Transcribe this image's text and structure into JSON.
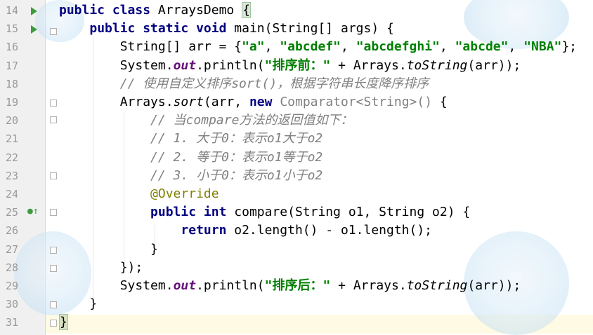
{
  "editor": {
    "lines": [
      {
        "n": "14",
        "segments": [
          {
            "c": "kw",
            "t": "public "
          },
          {
            "c": "kw",
            "t": "class "
          },
          {
            "c": "",
            "t": "ArraysDemo "
          },
          {
            "c": "brace-match",
            "t": "{"
          }
        ]
      },
      {
        "n": "15",
        "segments": [
          {
            "c": "",
            "t": "    "
          },
          {
            "c": "kw",
            "t": "public "
          },
          {
            "c": "kw",
            "t": "static "
          },
          {
            "c": "kw",
            "t": "void "
          },
          {
            "c": "",
            "t": "main(String[] args) {"
          }
        ]
      },
      {
        "n": "16",
        "segments": [
          {
            "c": "",
            "t": "        String[] arr = {"
          },
          {
            "c": "str",
            "t": "\"a\""
          },
          {
            "c": "",
            "t": ", "
          },
          {
            "c": "str",
            "t": "\"abcdef\""
          },
          {
            "c": "",
            "t": ", "
          },
          {
            "c": "str",
            "t": "\"abcdefghi\""
          },
          {
            "c": "",
            "t": ", "
          },
          {
            "c": "str",
            "t": "\"abcde\""
          },
          {
            "c": "",
            "t": ", "
          },
          {
            "c": "str",
            "t": "\"NBA\""
          },
          {
            "c": "",
            "t": "};"
          }
        ]
      },
      {
        "n": "17",
        "segments": [
          {
            "c": "",
            "t": "        System."
          },
          {
            "c": "static",
            "t": "out"
          },
          {
            "c": "",
            "t": ".println("
          },
          {
            "c": "str",
            "t": "\"排序前：\""
          },
          {
            "c": "",
            "t": " + Arrays."
          },
          {
            "c": "method-italic",
            "t": "toString"
          },
          {
            "c": "",
            "t": "(arr));"
          }
        ]
      },
      {
        "n": "18",
        "segments": [
          {
            "c": "cmt",
            "t": "        // 使用自定义排序sort()，根据字符串长度降序排序"
          }
        ]
      },
      {
        "n": "19",
        "segments": [
          {
            "c": "",
            "t": "        Arrays."
          },
          {
            "c": "method-italic",
            "t": "sort"
          },
          {
            "c": "",
            "t": "(arr, "
          },
          {
            "c": "kw",
            "t": "new "
          },
          {
            "c": "gray",
            "t": "Comparator<String>() "
          },
          {
            "c": "",
            "t": "{"
          }
        ]
      },
      {
        "n": "20",
        "segments": [
          {
            "c": "cmt",
            "t": "            // 当compare方法的返回值如下："
          }
        ]
      },
      {
        "n": "21",
        "segments": [
          {
            "c": "cmt",
            "t": "            // 1. 大于0：表示o1大于o2"
          }
        ]
      },
      {
        "n": "22",
        "segments": [
          {
            "c": "cmt",
            "t": "            // 2. 等于0：表示o1等于o2"
          }
        ]
      },
      {
        "n": "23",
        "segments": [
          {
            "c": "cmt",
            "t": "            // 3. 小于0：表示o1小于o2"
          }
        ]
      },
      {
        "n": "24",
        "segments": [
          {
            "c": "ann",
            "t": "            @Override"
          }
        ]
      },
      {
        "n": "25",
        "segments": [
          {
            "c": "",
            "t": "            "
          },
          {
            "c": "kw",
            "t": "public "
          },
          {
            "c": "kw",
            "t": "int "
          },
          {
            "c": "",
            "t": "compare(String o1, String o2) {"
          }
        ]
      },
      {
        "n": "26",
        "segments": [
          {
            "c": "",
            "t": "                "
          },
          {
            "c": "kw",
            "t": "return "
          },
          {
            "c": "",
            "t": "o2.length() - o1.length();"
          }
        ]
      },
      {
        "n": "27",
        "segments": [
          {
            "c": "",
            "t": "            }"
          }
        ]
      },
      {
        "n": "28",
        "segments": [
          {
            "c": "",
            "t": "        });"
          }
        ]
      },
      {
        "n": "29",
        "segments": [
          {
            "c": "",
            "t": "        System."
          },
          {
            "c": "static",
            "t": "out"
          },
          {
            "c": "",
            "t": ".println("
          },
          {
            "c": "str",
            "t": "\"排序后：\""
          },
          {
            "c": "",
            "t": " + Arrays."
          },
          {
            "c": "method-italic",
            "t": "toString"
          },
          {
            "c": "",
            "t": "(arr));"
          }
        ]
      },
      {
        "n": "30",
        "segments": [
          {
            "c": "",
            "t": "    }"
          }
        ]
      },
      {
        "n": "31",
        "segments": [
          {
            "c": "brace-match",
            "t": "}"
          }
        ]
      }
    ],
    "gutter_markers": {
      "run_lines": [
        "14",
        "15"
      ],
      "implements_line": "25",
      "implements_icon": "override-arrow-icon",
      "run_icon": "run-triangle-icon",
      "fold_icon": "fold-marker-icon"
    },
    "colors": {
      "keyword": "#000080",
      "string": "#008000",
      "comment": "#808080",
      "static_field": "#660e7a",
      "annotation": "#808000",
      "current_line": "#fffae3"
    }
  }
}
